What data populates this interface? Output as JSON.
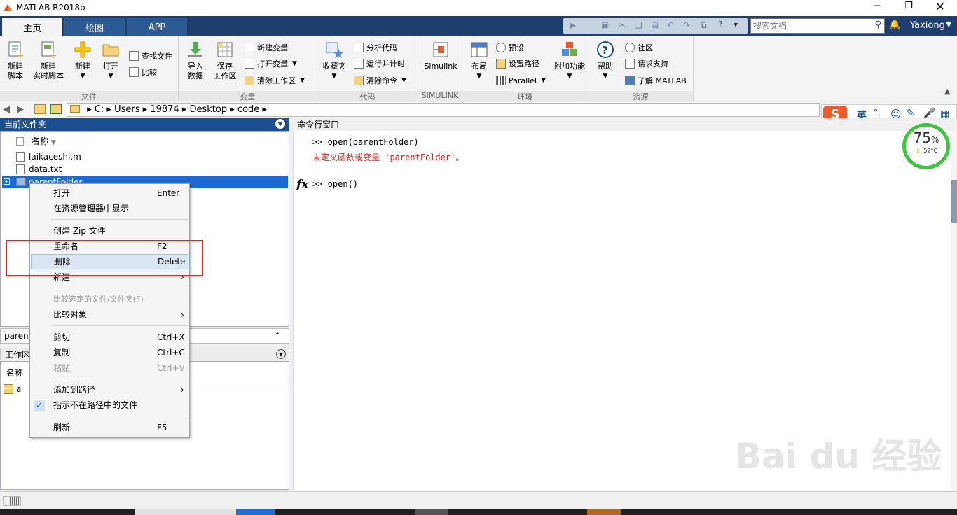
{
  "window": {
    "title": "MATLAB R2018b"
  },
  "tabs": [
    {
      "label": "主页"
    },
    {
      "label": "绘图"
    },
    {
      "label": "APP"
    }
  ],
  "search": {
    "placeholder": "搜索文档"
  },
  "user": {
    "name": "Yaxiong"
  },
  "ribbon": {
    "file": {
      "label": "文件",
      "new_script": "新建\n脚本",
      "new_live": "新建\n实时脚本",
      "new": "新建",
      "open": "打开",
      "find_files": "查找文件",
      "compare": "比较"
    },
    "variable": {
      "label": "变量",
      "import": "导入\n数据",
      "save_ws": "保存\n工作区",
      "new_var": "新建变量",
      "open_var": "打开变量",
      "clear_ws": "清除工作区"
    },
    "code": {
      "label": "代码",
      "favorites": "收藏夹",
      "analyze": "分析代码",
      "run_time": "运行并计时",
      "clear_cmd": "清除命令"
    },
    "simulink": {
      "label": "SIMULINK",
      "simulink": "Simulink"
    },
    "env": {
      "label": "环境",
      "layout": "布局",
      "prefs": "预设",
      "set_path": "设置路径",
      "parallel": "Parallel",
      "addons": "附加功能"
    },
    "resources": {
      "label": "资源",
      "help": "帮助",
      "community": "社区",
      "request_support": "请求支持",
      "learn": "了解 MATLAB"
    }
  },
  "address": {
    "crumbs": [
      "C:",
      "Users",
      "19874",
      "Desktop",
      "code"
    ]
  },
  "current_folder": {
    "title": "当前文件夹",
    "col_name": "名称",
    "files": [
      {
        "name": "laikaceshi.m"
      },
      {
        "name": "data.txt"
      },
      {
        "name": "parentFolder"
      }
    ],
    "detail": "parent"
  },
  "workspace": {
    "title": "工作区",
    "col_name": "名称",
    "vars": [
      {
        "name": "a"
      }
    ]
  },
  "context_menu": {
    "items": [
      {
        "label": "打开",
        "shortcut": "Enter"
      },
      {
        "label": "在资源管理器中显示",
        "shortcut": ""
      },
      {
        "label": "创建 Zip 文件",
        "shortcut": ""
      },
      {
        "label": "重命名",
        "shortcut": "F2"
      },
      {
        "label": "删除",
        "shortcut": "Delete"
      },
      {
        "label": "新建",
        "shortcut": ""
      },
      {
        "label": "比较选定的文件/文件夹(F)",
        "shortcut": ""
      },
      {
        "label": "比较对象",
        "shortcut": ""
      },
      {
        "label": "剪切",
        "shortcut": "Ctrl+X"
      },
      {
        "label": "复制",
        "shortcut": "Ctrl+C"
      },
      {
        "label": "粘贴",
        "shortcut": "Ctrl+V"
      },
      {
        "label": "添加到路径",
        "shortcut": ""
      },
      {
        "label": "指示不在路径中的文件",
        "shortcut": ""
      },
      {
        "label": "刷新",
        "shortcut": "F5"
      }
    ]
  },
  "command_window": {
    "title": "命令行窗口",
    "lines": [
      {
        "text": ">> open(parentFolder)"
      },
      {
        "text": "未定义函数或变量 'parentFolder'。"
      },
      {
        "text": ">> open()"
      }
    ],
    "fx": "fx"
  },
  "ime": {
    "lang": "英",
    "punct": "°,"
  },
  "gauge": {
    "percent": "75",
    "unit": "%",
    "temp": "52°C"
  },
  "colors": {
    "accent": "#1c4f91",
    "selection": "#1c6ad1",
    "error": "#e0231d"
  }
}
